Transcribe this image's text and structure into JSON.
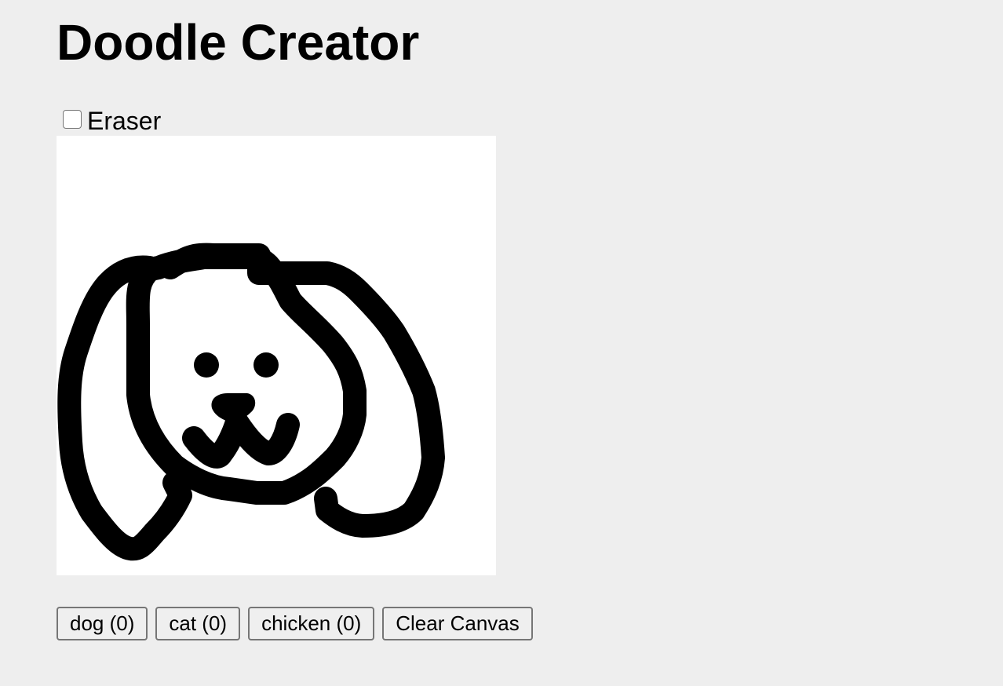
{
  "header": {
    "title": "Doodle Creator"
  },
  "eraser": {
    "label": "Eraser",
    "checked": false
  },
  "canvas": {
    "background": "#ffffff",
    "stroke_color": "#000000"
  },
  "buttons": {
    "dog": "dog (0)",
    "cat": "cat (0)",
    "chicken": "chicken (0)",
    "clear": "Clear Canvas"
  }
}
